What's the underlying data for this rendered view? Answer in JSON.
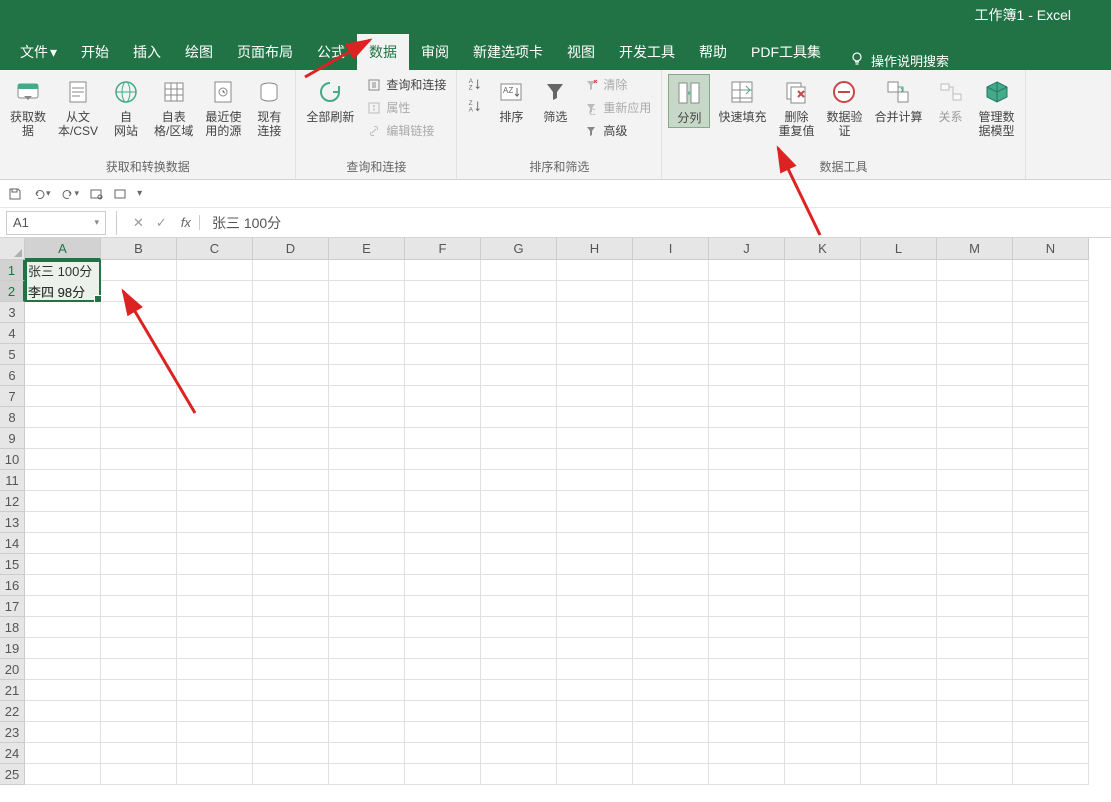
{
  "title": "工作簿1  -  Excel",
  "tabs": [
    "文件",
    "开始",
    "插入",
    "绘图",
    "页面布局",
    "公式",
    "数据",
    "审阅",
    "新建选项卡",
    "视图",
    "开发工具",
    "帮助",
    "PDF工具集"
  ],
  "active_tab_index": 6,
  "tell_me": "操作说明搜索",
  "ribbon": {
    "group1": {
      "label": "获取和转换数据",
      "btns": [
        "获取数\n据",
        "从文\n本/CSV",
        "自\n网站",
        "自表\n格/区域",
        "最近使\n用的源",
        "现有\n连接"
      ]
    },
    "group2": {
      "label": "查询和连接",
      "refresh": "全部刷新",
      "items": [
        "查询和连接",
        "属性",
        "编辑链接"
      ]
    },
    "group3": {
      "label": "排序和筛选",
      "sort": "排序",
      "filter": "筛选",
      "clear": "清除",
      "reapply": "重新应用",
      "advanced": "高级"
    },
    "group4": {
      "label": "数据工具",
      "btns": [
        "分列",
        "快速填充",
        "删除\n重复值",
        "数据验\n证",
        "合并计算",
        "关系",
        "管理数\n据模型"
      ]
    }
  },
  "name_box": "A1",
  "formula_value": "张三  100分",
  "columns": [
    "A",
    "B",
    "C",
    "D",
    "E",
    "F",
    "G",
    "H",
    "I",
    "J",
    "K",
    "L",
    "M",
    "N"
  ],
  "rows": 25,
  "cell_data": {
    "A1": "张三  100分",
    "A2": "李四  98分"
  }
}
